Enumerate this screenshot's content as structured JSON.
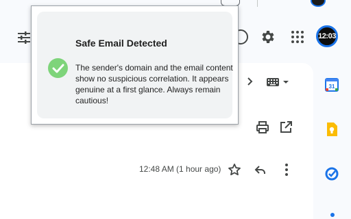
{
  "popup": {
    "title": "Safe Email Detected",
    "message": "The sender's domain and the email content show no suspicious correlation. It appears genuine at a first glance. Always remain cautious!",
    "status_color": "#7ed47a"
  },
  "header": {
    "avatar_text": "12:03"
  },
  "email": {
    "timestamp": "12:48 AM (1 hour ago)"
  },
  "side_panel": {
    "calendar_day": "31"
  },
  "icons": {
    "filter": "filter-icon",
    "help": "help-icon",
    "settings": "gear-icon",
    "apps": "apps-grid-icon",
    "next": "chevron-right-icon",
    "keyboard": "keyboard-icon",
    "print": "print-icon",
    "popout": "open-in-new-icon",
    "star": "star-icon",
    "reply": "reply-icon",
    "more": "more-vert-icon",
    "calendar": "calendar-icon",
    "keep": "keep-icon",
    "tasks": "tasks-icon"
  },
  "colors": {
    "accent": "#1a73e8",
    "check": "#7ed47a"
  }
}
